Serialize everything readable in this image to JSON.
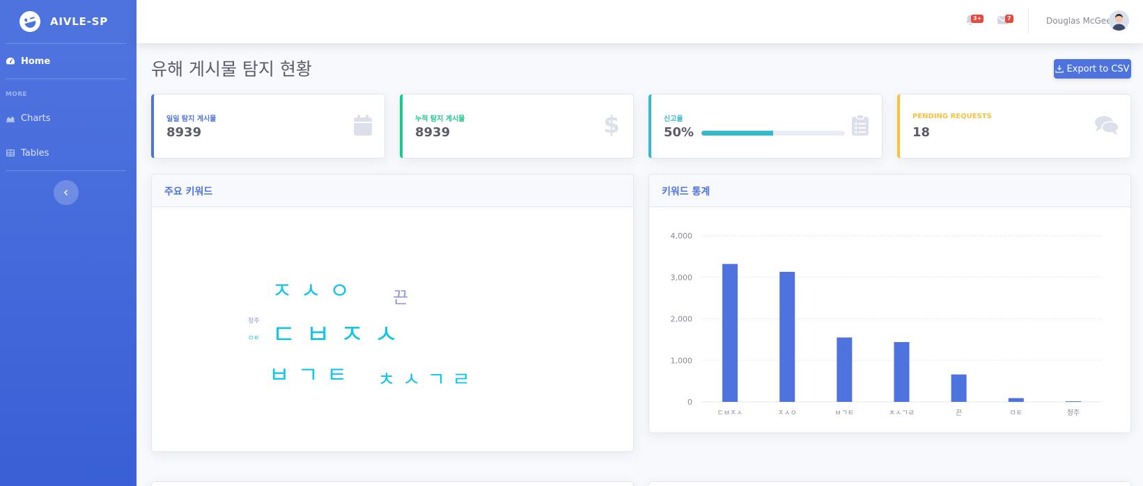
{
  "sidebar": {
    "brand": "AIVLE-SP",
    "home_label": "Home",
    "heading": "MORE",
    "charts_label": "Charts",
    "tables_label": "Tables"
  },
  "topbar": {
    "alerts_badge": "3+",
    "messages_badge": "7",
    "user_name": "Douglas McGee"
  },
  "page": {
    "title": "유해 게시물 탐지 현황",
    "export_label": "Export to CSV"
  },
  "stats": [
    {
      "label": "일일 탐지 게시물",
      "value": "8939",
      "color": "#4e73df",
      "icon": "calendar-icon"
    },
    {
      "label": "누적 탐지 게시물",
      "value": "8939",
      "color": "#1cc88a",
      "icon": "dollar-icon"
    },
    {
      "label": "신고율",
      "value": "50%",
      "progress": 0.5,
      "color": "#36b9cc",
      "icon": "clipboard-icon"
    },
    {
      "label": "PENDING REQUESTS",
      "value": "18",
      "color": "#f6c23e",
      "icon": "comments-icon"
    }
  ],
  "wordcloud": {
    "title": "주요 키워드",
    "words": [
      "ㅈㅅㅇ",
      "끈",
      "청주",
      "ㅁㅌ",
      "ㄷㅂㅈㅅ",
      "ㅂㄱㅌ",
      "ㅊㅅㄱㄹ"
    ]
  },
  "chart_data": {
    "type": "bar",
    "title": "키워드 통계",
    "categories": [
      "ㄷㅂㅈㅅ",
      "ㅈㅅㅇ",
      "ㅂㄱㅌ",
      "ㅊㅅㄱㄹ",
      "끈",
      "ㅁㅌ",
      "청주"
    ],
    "values": [
      3320,
      3130,
      1550,
      1440,
      660,
      90,
      15
    ],
    "yticks": [
      "0",
      "1,000",
      "2,000",
      "3,000",
      "4,000"
    ],
    "ylim": [
      0,
      4000
    ],
    "color": "#4e73df",
    "grid": true
  }
}
